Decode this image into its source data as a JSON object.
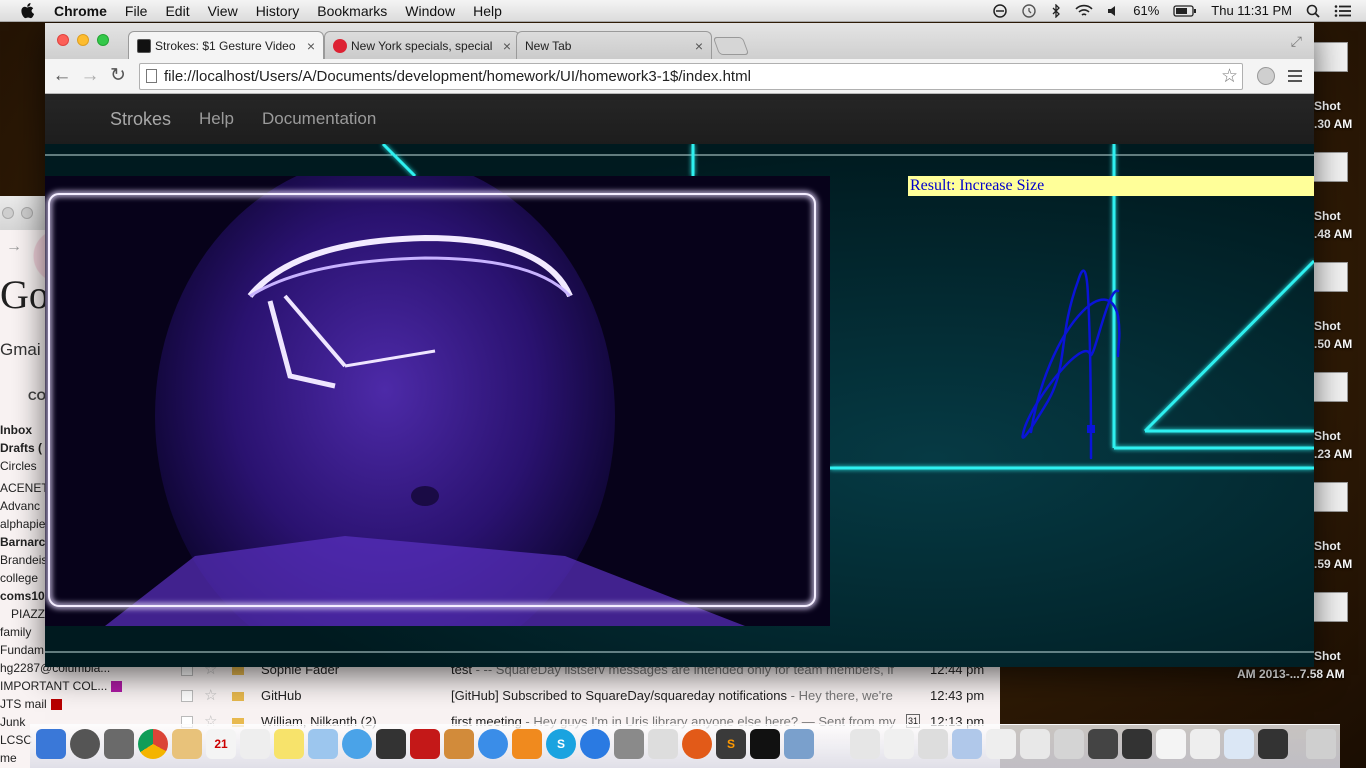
{
  "menubar": {
    "app_name": "Chrome",
    "items": [
      "File",
      "Edit",
      "View",
      "History",
      "Bookmarks",
      "Window",
      "Help"
    ],
    "battery": "61%",
    "clock": "Thu 11:31 PM"
  },
  "browser": {
    "tabs": [
      {
        "label": "Strokes: $1 Gesture Video",
        "active": true
      },
      {
        "label": "New York specials, special",
        "active": false
      },
      {
        "label": "New Tab",
        "active": false
      }
    ],
    "url": "file://localhost/Users/A/Documents/development/homework/UI/homework3-1$/index.html"
  },
  "page": {
    "nav": {
      "brand": "Strokes",
      "links": [
        "Help",
        "Documentation"
      ]
    },
    "result": "Result: Increase Size"
  },
  "gmail": {
    "logo": "Go",
    "title": "Gmai",
    "compose": "CO",
    "labels": [
      {
        "text": "Inbox",
        "bold": true
      },
      {
        "text": "Drafts (",
        "bold": true
      },
      {
        "text": "Circles",
        "bold": false
      },
      {
        "text": "ACENET",
        "bold": false
      },
      {
        "text": "Advanc",
        "bold": false
      },
      {
        "text": "alphapie",
        "bold": false
      },
      {
        "text": "Barnarc",
        "bold": true
      },
      {
        "text": "Brandeis",
        "bold": false
      },
      {
        "text": "college",
        "bold": false
      },
      {
        "text": "coms10",
        "bold": true
      },
      {
        "text": "PIAZZ",
        "bold": false,
        "indent": true
      },
      {
        "text": "family",
        "bold": false
      },
      {
        "text": "Fundam",
        "bold": false
      },
      {
        "text": "hg2287@columbia...",
        "bold": false
      },
      {
        "text": "IMPORTANT COL...",
        "bold": false,
        "swatch": "#b01aa6"
      },
      {
        "text": "JTS mail",
        "bold": false,
        "swatch": "#b80000"
      },
      {
        "text": "Junk",
        "bold": false
      },
      {
        "text": "LCSC",
        "bold": false
      },
      {
        "text": "me",
        "bold": false
      }
    ],
    "rows": [
      {
        "sender": "Sophie Fader",
        "subject": "test",
        "snippet": " - -- SquareDay listserv messages are intended only for team members, if",
        "time": "12:44 pm"
      },
      {
        "sender": "GitHub",
        "subject": "[GitHub] Subscribed to SquareDay/squareday notifications",
        "snippet": " - Hey there, we're",
        "time": "12:43 pm"
      },
      {
        "sender": "William, Nilkanth (2)",
        "subject": "first meeting",
        "snippet": " - Hey guys I'm in Uris library anyone else here? — Sent from my",
        "time": "12:13 pm",
        "calendar": "31"
      }
    ]
  },
  "desktop": {
    "icon_labels": [
      "Shot",
      ".30 AM",
      "Shot",
      ".48 AM",
      "Shot",
      ".50 AM",
      "Shot",
      ".23 AM",
      "Shot",
      ".59 AM",
      "Shot"
    ],
    "bottom_label": "AM 2013-...7.58 AM"
  },
  "colors": {
    "result_bg": "#ffff99",
    "result_text": "#0000cc",
    "tron_line": "#2ef0f0",
    "gesture_stroke": "#0a14d8"
  }
}
